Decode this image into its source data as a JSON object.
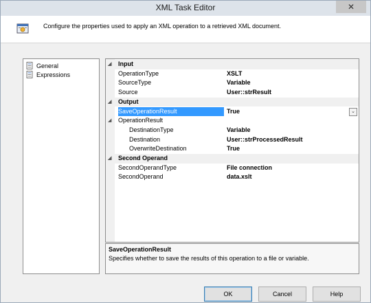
{
  "window": {
    "title": "XML Task Editor",
    "close_glyph": "✕"
  },
  "header": {
    "text": "Configure the properties used to apply an XML operation to a retrieved XML document.",
    "icon": "xml-task-icon"
  },
  "nav": [
    {
      "label": "General",
      "icon": "page-icon"
    },
    {
      "label": "Expressions",
      "icon": "page-icon"
    }
  ],
  "grid": {
    "categories": {
      "input": "Input",
      "output": "Output",
      "second_operand": "Second Operand",
      "operation_result": "OperationResult"
    },
    "input": [
      {
        "name": "OperationType",
        "value": "XSLT"
      },
      {
        "name": "SourceType",
        "value": "Variable"
      },
      {
        "name": "Source",
        "value": "User::strResult"
      }
    ],
    "output": {
      "save_name": "SaveOperationResult",
      "save_value": "True",
      "result_items": [
        {
          "name": "DestinationType",
          "value": "Variable"
        },
        {
          "name": "Destination",
          "value": "User::strProcessedResult"
        },
        {
          "name": "OverwriteDestination",
          "value": "True"
        }
      ]
    },
    "second_operand": [
      {
        "name": "SecondOperandType",
        "value": "File connection"
      },
      {
        "name": "SecondOperand",
        "value": "data.xslt"
      }
    ],
    "collapse_glyph": "◢",
    "dropdown_glyph": "⌄"
  },
  "description": {
    "title": "SaveOperationResult",
    "text": "Specifies whether to save the results of this operation to a file or variable."
  },
  "buttons": {
    "ok": "OK",
    "cancel": "Cancel",
    "help": "Help"
  },
  "colors": {
    "selection": "#3399ff",
    "accent": "#3c7fb1"
  }
}
